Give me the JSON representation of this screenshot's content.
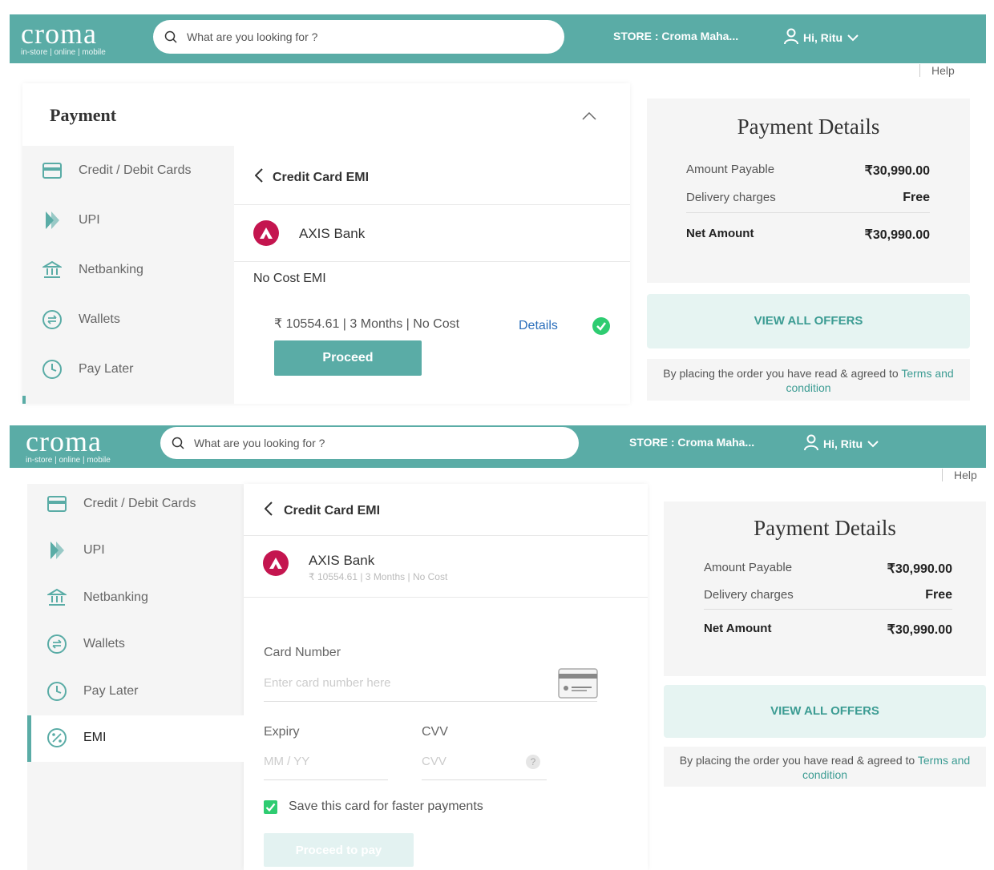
{
  "colors": {
    "brand": "#5aaca6",
    "link": "#3c9c93",
    "axis": "#c4154f",
    "success": "#2ecc71"
  },
  "header": {
    "logo_word": "croma",
    "logo_tagline": "in-store | online | mobile",
    "search_placeholder": "What are you looking for ?",
    "store": "STORE : Croma Maha...",
    "user": "Hi, Ritu"
  },
  "help": "Help",
  "payment": {
    "title": "Payment",
    "methods": [
      {
        "label": "Credit / Debit Cards",
        "icon": "card-icon"
      },
      {
        "label": "UPI",
        "icon": "upi-icon"
      },
      {
        "label": "Netbanking",
        "icon": "bank-icon"
      },
      {
        "label": "Wallets",
        "icon": "wallet-icon"
      },
      {
        "label": "Pay Later",
        "icon": "clock-icon"
      },
      {
        "label": "EMI",
        "icon": "percent-icon"
      }
    ],
    "emi_back_label": "Credit Card EMI",
    "bank_name": "AXIS Bank",
    "no_cost_emi": "No Cost EMI",
    "emi_plan": "₹ 10554.61 | 3 Months | No Cost",
    "details_link": "Details",
    "proceed": "Proceed",
    "card_number_label": "Card Number",
    "card_number_placeholder": "Enter card number here",
    "expiry_label": "Expiry",
    "expiry_placeholder": "MM / YY",
    "cvv_label": "CVV",
    "cvv_placeholder": "CVV",
    "cvv_help": "?",
    "save_card": "Save this card for faster payments",
    "proceed_to_pay": "Proceed to pay"
  },
  "summary": {
    "title": "Payment Details",
    "amount_payable_label": "Amount Payable",
    "amount_payable": "₹30,990.00",
    "delivery_label": "Delivery charges",
    "delivery": "Free",
    "net_label": "Net Amount",
    "net": "₹30,990.00",
    "offers": "VIEW ALL OFFERS",
    "terms_text": "By placing the order you have read & agreed to ",
    "terms_link_1": "Terms and",
    "terms_link_2": "condition"
  }
}
